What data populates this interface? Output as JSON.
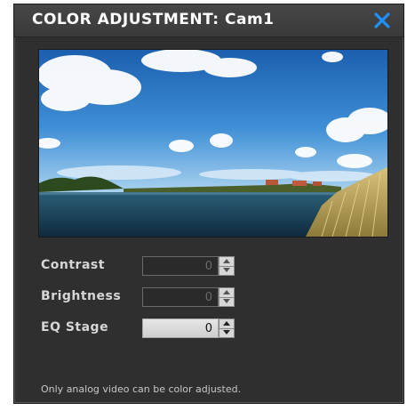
{
  "dialog": {
    "title": "COLOR ADJUSTMENT: Cam1",
    "close_icon": "close-x-icon",
    "accent_color": "#1e90ff"
  },
  "preview": {
    "description_icon": "landscape-image"
  },
  "controls": [
    {
      "label": "Contrast",
      "value": "0",
      "enabled": false
    },
    {
      "label": "Brightness",
      "value": "0",
      "enabled": false
    },
    {
      "label": "EQ Stage",
      "value": "0",
      "enabled": true
    }
  ],
  "footer": {
    "note": "Only analog video can be color adjusted."
  }
}
